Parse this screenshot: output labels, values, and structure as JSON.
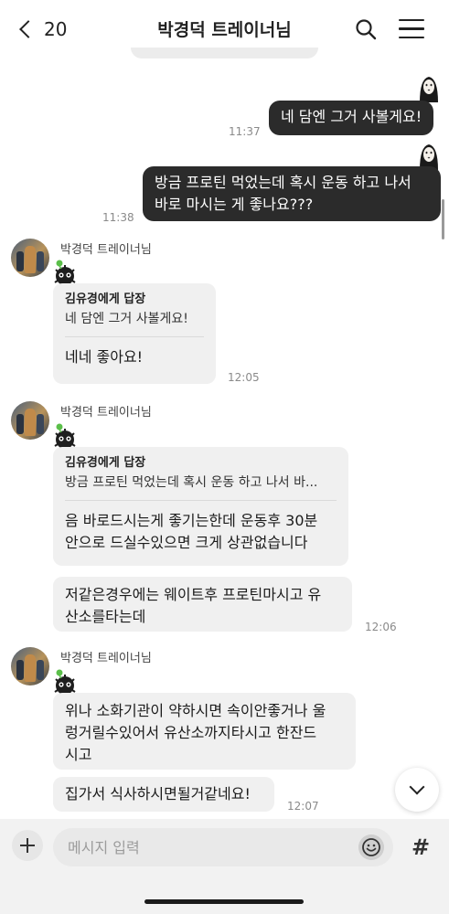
{
  "header": {
    "back_count": "20",
    "title": "박경덕 트레이너님"
  },
  "messages": {
    "out1": {
      "text": "네 담엔 그거 사볼게요!",
      "time": "11:37"
    },
    "out2": {
      "line1": "방금 프로틴 먹었는데 혹시 운동 하고 나서",
      "line2": "바로 마시는 게 좋나요???",
      "time": "11:38"
    },
    "group1": {
      "sender": "박경덕 트레이너님",
      "reply_header": "김유경에게 답장",
      "reply_quote": "네 담엔 그거 사볼게요!",
      "reply_text": "네네 좋아요!",
      "time": "12:05"
    },
    "group2": {
      "sender": "박경덕 트레이너님",
      "reply_header": "김유경에게 답장",
      "reply_quote": "방금 프로틴 먹었는데 혹시 운동 하고 나서 바...",
      "reply_line1": "음 바로드시는게 좋기는한데 운동후 30분",
      "reply_line2": "안으로 드실수있으면 크게 상관없습니다",
      "msg2_line1": "저같은경우에는 웨이트후 프로틴마시고 유",
      "msg2_line2": "산소를타는데",
      "time": "12:06"
    },
    "group3": {
      "sender": "박경덕 트레이너님",
      "msg1_line1": "위나 소화기관이 약하시면 속이안좋거나 울",
      "msg1_line2": "렁거릴수있어서 유산소까지타시고 한잔드",
      "msg1_line3": "시고",
      "msg2": "집가서 식사하시면될거같네요!",
      "time": "12:07"
    }
  },
  "input": {
    "placeholder": "메시지 입력",
    "hash_label": "#"
  },
  "icons": {
    "back": "chevron-left-icon",
    "search": "search-icon",
    "menu": "hamburger-menu-icon",
    "scroll_down": "chevron-down-icon",
    "plus": "plus-icon",
    "emoji": "emoji-icon"
  },
  "colors": {
    "outgoing_bubble": "#2b2b2b",
    "incoming_bubble": "#f0f0f0",
    "input_bar": "#f2f2f2"
  }
}
